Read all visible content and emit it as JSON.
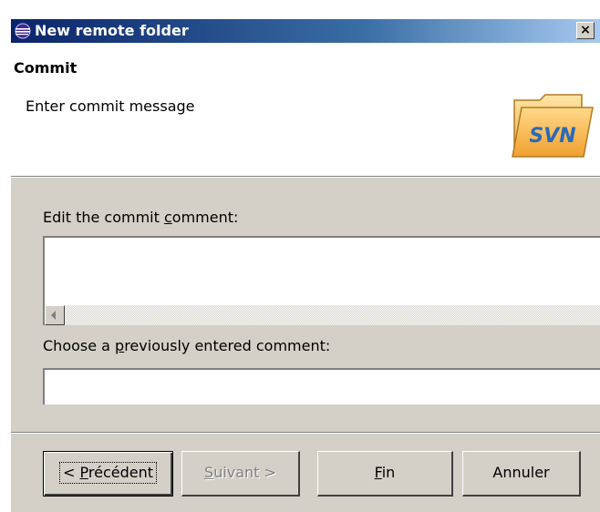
{
  "window": {
    "title": "New remote folder",
    "close_glyph": "×"
  },
  "banner": {
    "title": "Commit",
    "description": "Enter commit message",
    "icon_text": "SVN",
    "icon": "svn-folder-icon"
  },
  "form": {
    "comment_label_pre": "Edit the commit ",
    "comment_label_mnemonic": "c",
    "comment_label_post": "omment:",
    "comment_value": "",
    "previous_label_pre": "Choose a ",
    "previous_label_mnemonic": "p",
    "previous_label_post": "reviously entered comment:",
    "previous_value": ""
  },
  "buttons": {
    "back_pre": "< ",
    "back_mnemonic": "P",
    "back_post": "récédent",
    "next_mnemonic": "S",
    "next_post": "uivant >",
    "finish_mnemonic": "F",
    "finish_post": "in",
    "cancel": "Annuler"
  },
  "colors": {
    "title_bar_start": "#0a246a",
    "title_bar_end": "#a6caf0",
    "dialog_bg": "#d4d0c8",
    "folder_orange": "#f0a030",
    "svn_blue": "#2a6ab8"
  }
}
